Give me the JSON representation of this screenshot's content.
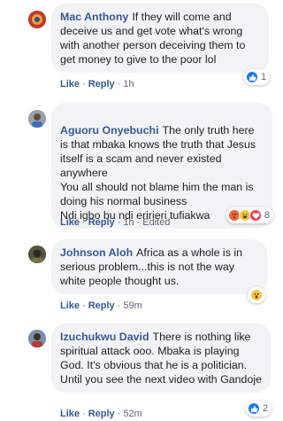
{
  "comments": [
    {
      "author": "Mac Anthony",
      "text": "If they will come and deceive us and get vote what's wrong with another person deceiving them to get money to give to the poor lol",
      "like_label": "Like",
      "reply_label": "Reply",
      "time": "1h",
      "edited": "",
      "reaction_count": "1",
      "reactions": [
        "like-icon"
      ]
    },
    {
      "author": "Aguoru Onyebuchi",
      "text": "The only truth here is that mbaka knows the truth that Jesus itself is a scam and never existed anywhere\nYou all should not blame him the man is doing his normal business\nNdi igbo bu ndi eririeri tufiakwa",
      "like_label": "Like",
      "reply_label": "Reply",
      "time": "1h",
      "edited": "Edited",
      "reaction_count": "8",
      "reactions": [
        "angry-icon",
        "haha-icon",
        "love-icon"
      ]
    },
    {
      "author": "Johnson Aloh",
      "text": "Africa as a whole is in serious problem...this is not the way white people thought us.",
      "like_label": "Like",
      "reply_label": "Reply",
      "time": "59m",
      "edited": "",
      "reaction_count": "",
      "reactions": [
        "wow-icon"
      ]
    },
    {
      "author": "Izuchukwu David",
      "text": "There is nothing like spiritual attack ooo. Mbaka is playing God. It's obvious that he is a politician. Until you see the next video with Gandoje",
      "like_label": "Like",
      "reply_label": "Reply",
      "time": "52m",
      "edited": "",
      "reaction_count": "2",
      "reactions": [
        "like-icon"
      ]
    }
  ],
  "colors": {
    "author_link": "#385898",
    "bubble_bg": "#f2f3f5",
    "meta_text": "#606770",
    "like_blue": "#1877f2"
  }
}
